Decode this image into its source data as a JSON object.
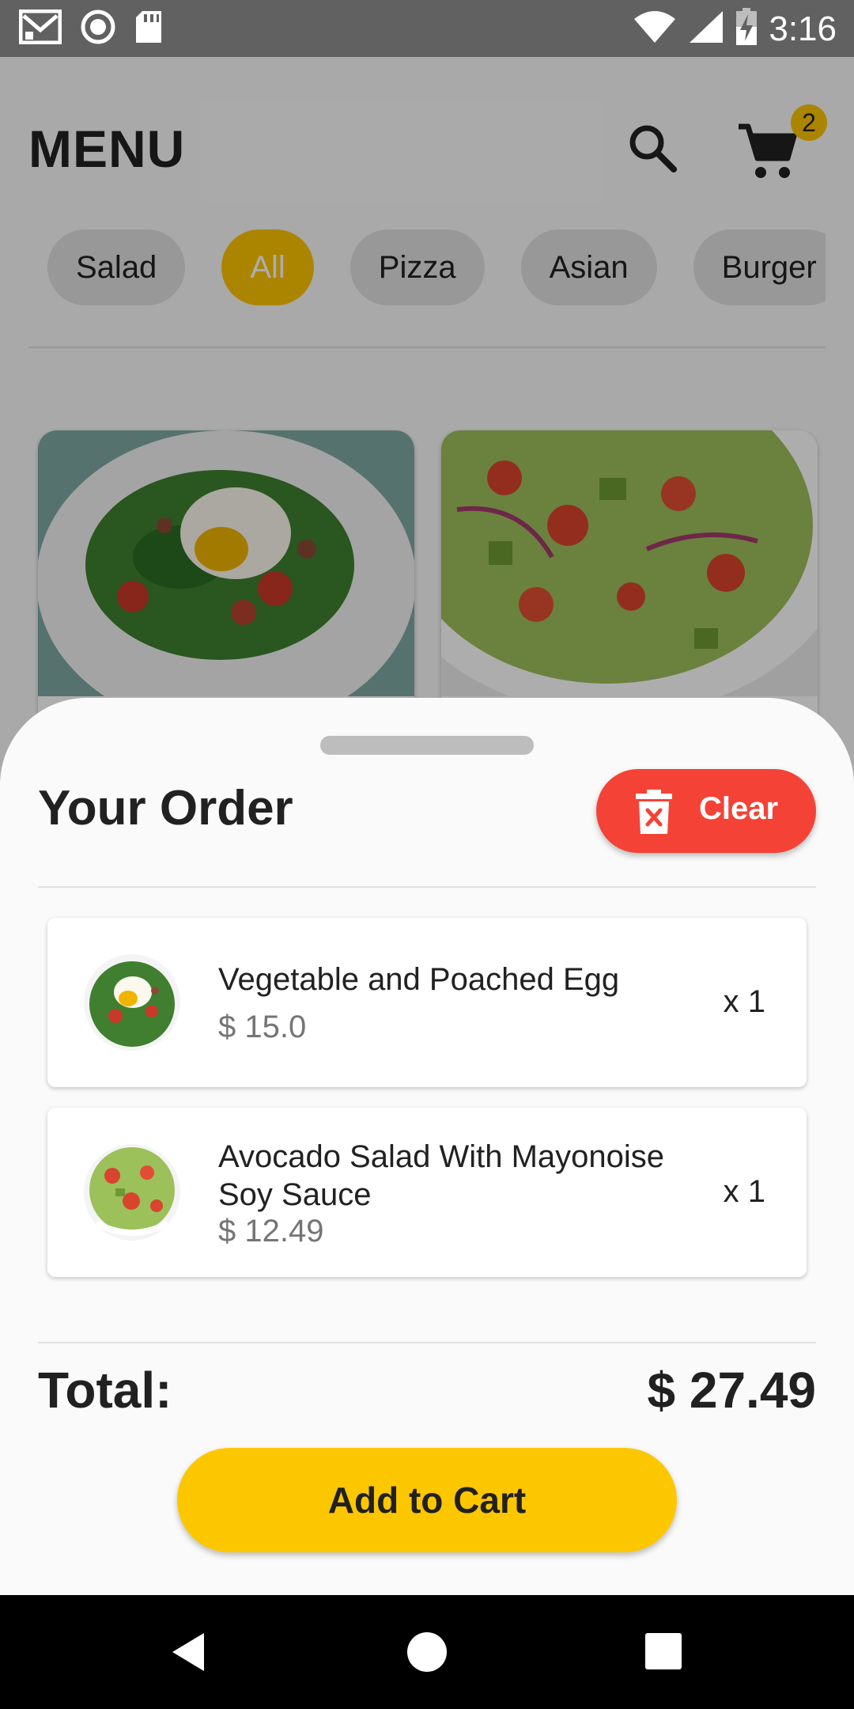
{
  "status_bar": {
    "time": "3:16",
    "icons": [
      "gmail-icon",
      "record-icon",
      "sd-card-icon",
      "wifi-icon",
      "signal-icon",
      "battery-charging-icon"
    ]
  },
  "header": {
    "title": "MENU",
    "search_icon": "search-icon",
    "cart_icon": "cart-icon",
    "cart_count": "2"
  },
  "categories": [
    {
      "label": "Salad",
      "active": false
    },
    {
      "label": "All",
      "active": true
    },
    {
      "label": "Pizza",
      "active": false
    },
    {
      "label": "Asian",
      "active": false
    },
    {
      "label": "Burger",
      "active": false
    }
  ],
  "order_sheet": {
    "title": "Your Order",
    "clear_label": "Clear",
    "clear_icon": "trash-icon",
    "items": [
      {
        "name": "Vegetable and Poached Egg",
        "price": "$ 15.0",
        "qty": "x 1"
      },
      {
        "name": "Avocado Salad With Mayonoise Soy Sauce",
        "price": "$ 12.49",
        "qty": "x 1"
      }
    ],
    "total_label": "Total:",
    "total_value": "$ 27.49",
    "add_to_cart_label": "Add to Cart"
  },
  "colors": {
    "accent": "#fdc500",
    "danger": "#f44336",
    "status_bar": "#616161"
  },
  "nav_bar": {
    "icons": [
      "back-icon",
      "home-icon",
      "recents-icon"
    ]
  }
}
